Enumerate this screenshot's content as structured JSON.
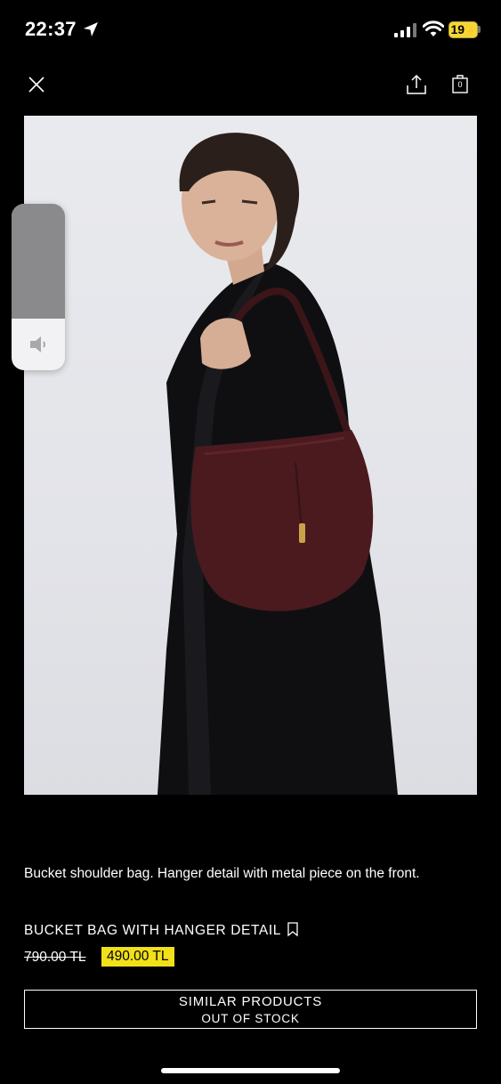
{
  "status_bar": {
    "time": "22:37",
    "battery": "19",
    "battery_color": "#f3d73a"
  },
  "header": {
    "close_icon": "close-icon",
    "share_icon": "share-icon",
    "bag_icon": "shopping-bag-icon",
    "bag_count": "0"
  },
  "volume_hud": {
    "level": 0.31,
    "icon": "speaker-icon"
  },
  "product": {
    "image_alt": "",
    "description": "Bucket shoulder bag. Hanger detail with metal piece on the front.",
    "name": "BUCKET BAG WITH HANGER DETAIL",
    "old_price": "790.00 TL",
    "new_price": "490.00 TL",
    "sale_color": "#f1e01a"
  },
  "similar": {
    "title": "SIMILAR PRODUCTS",
    "subtitle": "OUT OF STOCK"
  }
}
